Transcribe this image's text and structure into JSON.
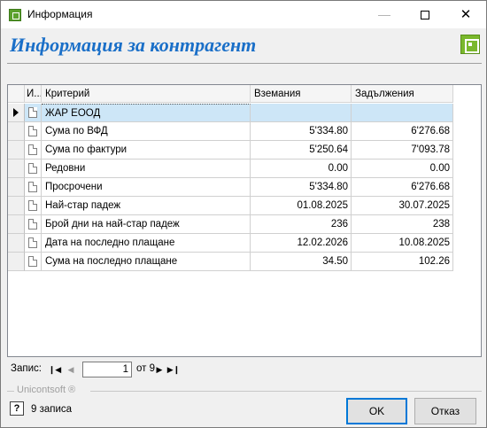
{
  "window": {
    "title": "Информация"
  },
  "heading": "Информация за контрагент",
  "grid": {
    "columns": [
      "И...",
      "Критерий",
      "Вземания",
      "Задължения"
    ],
    "group_row": "ЖАР ЕООД",
    "rows": [
      {
        "criterion": "Сума по ВФД",
        "receivables": "5'334.80",
        "payables": "6'276.68"
      },
      {
        "criterion": "Сума по фактури",
        "receivables": "5'250.64",
        "payables": "7'093.78"
      },
      {
        "criterion": "Редовни",
        "receivables": "0.00",
        "payables": "0.00"
      },
      {
        "criterion": "Просрочени",
        "receivables": "5'334.80",
        "payables": "6'276.68"
      },
      {
        "criterion": "Най-стар падеж",
        "receivables": "01.08.2025",
        "payables": "30.07.2025"
      },
      {
        "criterion": "Брой дни на най-стар падеж",
        "receivables": "236",
        "payables": "238"
      },
      {
        "criterion": "Дата на последно плащане",
        "receivables": "12.02.2026",
        "payables": "10.08.2025"
      },
      {
        "criterion": "Сума на последно плащане",
        "receivables": "34.50",
        "payables": "102.26"
      }
    ]
  },
  "navigator": {
    "label": "Запис:",
    "current": "1",
    "of_text": "от 9"
  },
  "footer": {
    "group_label": "Unicontsoft ®",
    "status": "9 записа",
    "ok_label": "OK",
    "cancel_label": "Отказ"
  }
}
